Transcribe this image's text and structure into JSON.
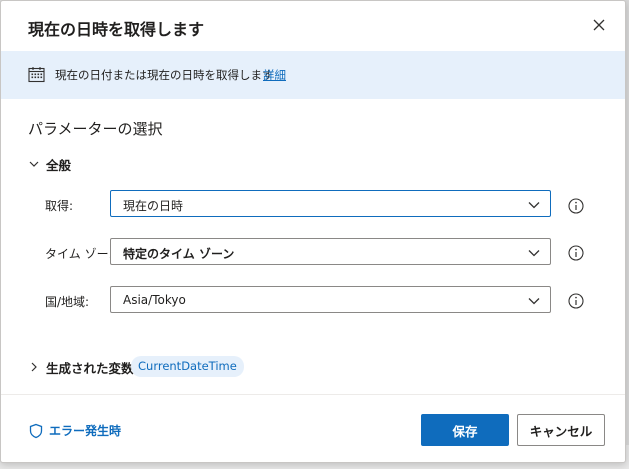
{
  "dialog": {
    "title": "現在の日時を取得します",
    "close_icon": "close-icon"
  },
  "banner": {
    "text": "現在の日付または現在の日時を取得します",
    "link": "詳細",
    "icon": "calendar-icon"
  },
  "parameters": {
    "heading": "パラメーターの選択",
    "group_label": "全般",
    "rows": [
      {
        "label": "取得:",
        "value": "現在の日時"
      },
      {
        "label": "タイム ゾーン:",
        "value": "特定のタイム ゾーン"
      },
      {
        "label": "国/地域:",
        "value": "Asia/Tokyo"
      }
    ]
  },
  "variables": {
    "label": "生成された変数",
    "chip": "CurrentDateTime"
  },
  "footer": {
    "on_error": "エラー発生時",
    "save": "保存",
    "cancel": "キャンセル"
  },
  "colors": {
    "accent": "#0f6cbd",
    "banner_bg": "#e6f0fb"
  }
}
